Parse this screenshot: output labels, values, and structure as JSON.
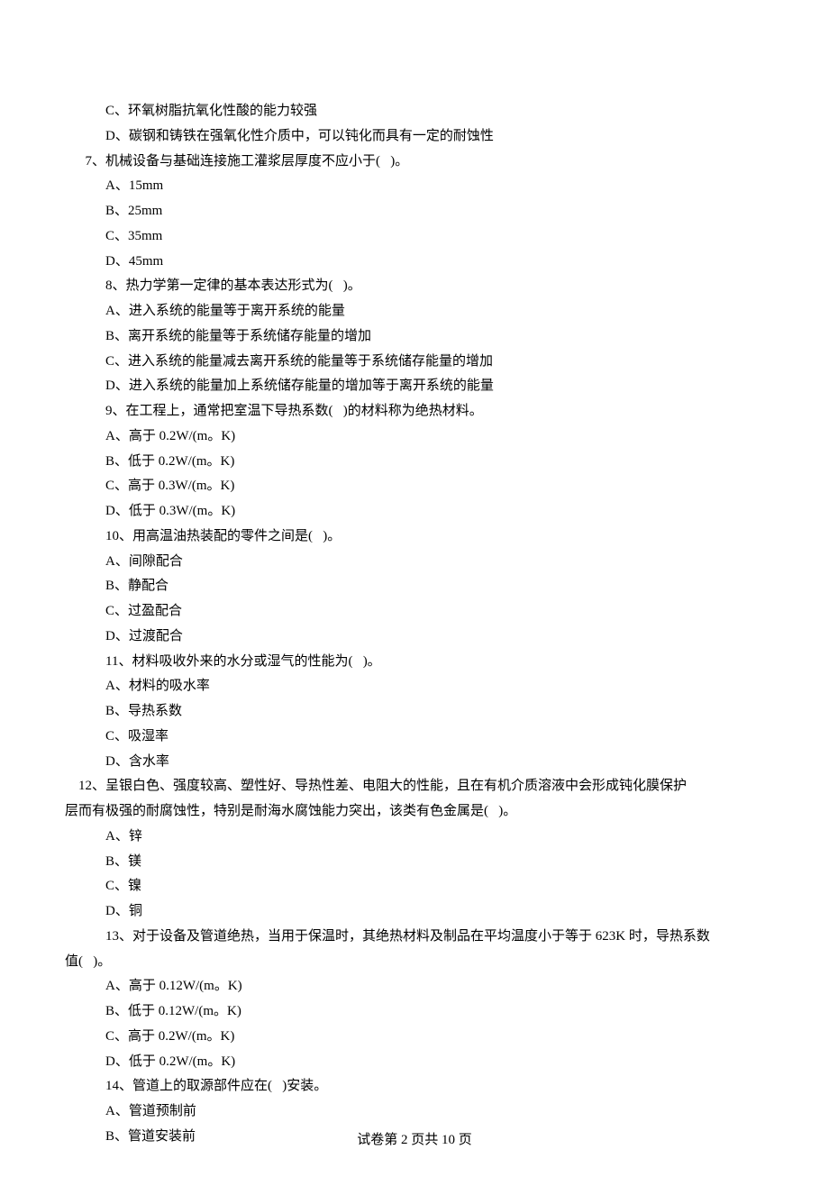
{
  "lines": {
    "q6c": "C、环氧树脂抗氧化性酸的能力较强",
    "q6d": "D、碳钢和铸铁在强氧化性介质中，可以钝化而具有一定的耐蚀性",
    "q7": "7、机械设备与基础连接施工灌浆层厚度不应小于(   )。",
    "q7a": "A、15mm",
    "q7b": "B、25mm",
    "q7c": "C、35mm",
    "q7d": "D、45mm",
    "q8": "8、热力学第一定律的基本表达形式为(   )。",
    "q8a": "A、进入系统的能量等于离开系统的能量",
    "q8b": "B、离开系统的能量等于系统储存能量的增加",
    "q8c": "C、进入系统的能量减去离开系统的能量等于系统储存能量的增加",
    "q8d": "D、进入系统的能量加上系统储存能量的增加等于离开系统的能量",
    "q9": "9、在工程上，通常把室温下导热系数(   )的材料称为绝热材料。",
    "q9a": "A、高于 0.2W/(m。K)",
    "q9b": "B、低于 0.2W/(m。K)",
    "q9c": "C、高于 0.3W/(m。K)",
    "q9d": "D、低于 0.3W/(m。K)",
    "q10": "10、用高温油热装配的零件之间是(   )。",
    "q10a": "A、间隙配合",
    "q10b": "B、静配合",
    "q10c": "C、过盈配合",
    "q10d": "D、过渡配合",
    "q11": "11、材料吸收外来的水分或湿气的性能为(   )。",
    "q11a": "A、材料的吸水率",
    "q11b": "B、导热系数",
    "q11c": "C、吸湿率",
    "q11d": "D、含水率",
    "q12l1": "12、呈银白色、强度较高、塑性好、导热性差、电阻大的性能，且在有机介质溶液中会形成钝化膜保护",
    "q12l2": "层而有极强的耐腐蚀性，特别是耐海水腐蚀能力突出，该类有色金属是(   )。",
    "q12a": "A、锌",
    "q12b": "B、镁",
    "q12c": "C、镍",
    "q12d": "D、铜",
    "q13l1": "13、对于设备及管道绝热，当用于保温时，其绝热材料及制品在平均温度小于等于 623K 时，导热系数",
    "q13l2": "值(   )。",
    "q13a": "A、高于 0.12W/(m。K)",
    "q13b": "B、低于 0.12W/(m。K)",
    "q13c": "C、高于 0.2W/(m。K)",
    "q13d": "D、低于 0.2W/(m。K)",
    "q14": "14、管道上的取源部件应在(   )安装。",
    "q14a": "A、管道预制前",
    "q14b": "B、管道安装前"
  },
  "footer": "试卷第 2 页共 10 页"
}
